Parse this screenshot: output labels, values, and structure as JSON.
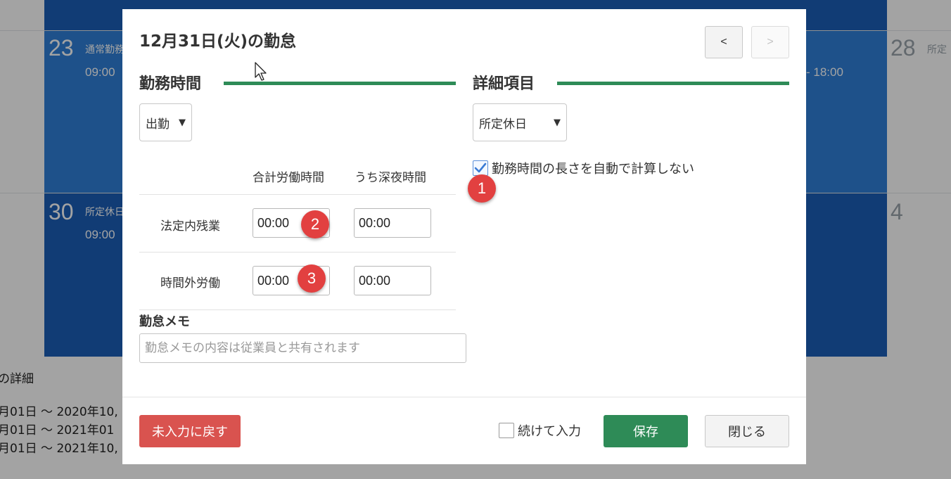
{
  "calendar": {
    "cells": [
      {
        "day": "23",
        "line1": "通常勤務",
        "line2": "09:00"
      },
      {
        "day": "30",
        "line1": "所定休日",
        "line2": "09:00"
      },
      {
        "day": "28",
        "line1": "所定"
      },
      {
        "day": "4"
      }
    ],
    "right_time": "- 18:00"
  },
  "details_section": {
    "heading": "の詳細",
    "rows": [
      "月01日 〜 2020年10,",
      "月01日 〜 2021年01",
      "月01日 〜 2021年10,"
    ]
  },
  "modal": {
    "title": "12月31日(火)の勤怠",
    "prev_label": "<",
    "next_label": ">",
    "work_time": {
      "section_title": "勤務時間",
      "type_select": "出勤",
      "col_total": "合計労働時間",
      "col_night": "うち深夜時間",
      "rows": [
        {
          "label": "法定内残業",
          "total": "00:00",
          "night": "00:00"
        },
        {
          "label": "時間外労働",
          "total": "00:00",
          "night": "00:00"
        }
      ]
    },
    "details": {
      "section_title": "詳細項目",
      "day_type_select": "所定休日",
      "auto_calc_label": "勤務時間の長さを自動で計算しない",
      "auto_calc_checked": true
    },
    "memo": {
      "label": "勤怠メモ",
      "placeholder": "勤怠メモの内容は従業員と共有されます"
    },
    "footer": {
      "reset_label": "未入力に戻す",
      "continue_label": "続けて入力",
      "save_label": "保存",
      "close_label": "閉じる"
    }
  },
  "annotations": [
    "1",
    "2",
    "3"
  ],
  "colors": {
    "accent_green": "#2e8b57",
    "danger_red": "#d9534f",
    "badge_red": "#e24040",
    "calendar_blue": "#2f7fd8"
  },
  "icons": {
    "dropdown": "triangle-down-icon",
    "check": "check-icon",
    "cursor": "mouse-pointer-icon"
  }
}
